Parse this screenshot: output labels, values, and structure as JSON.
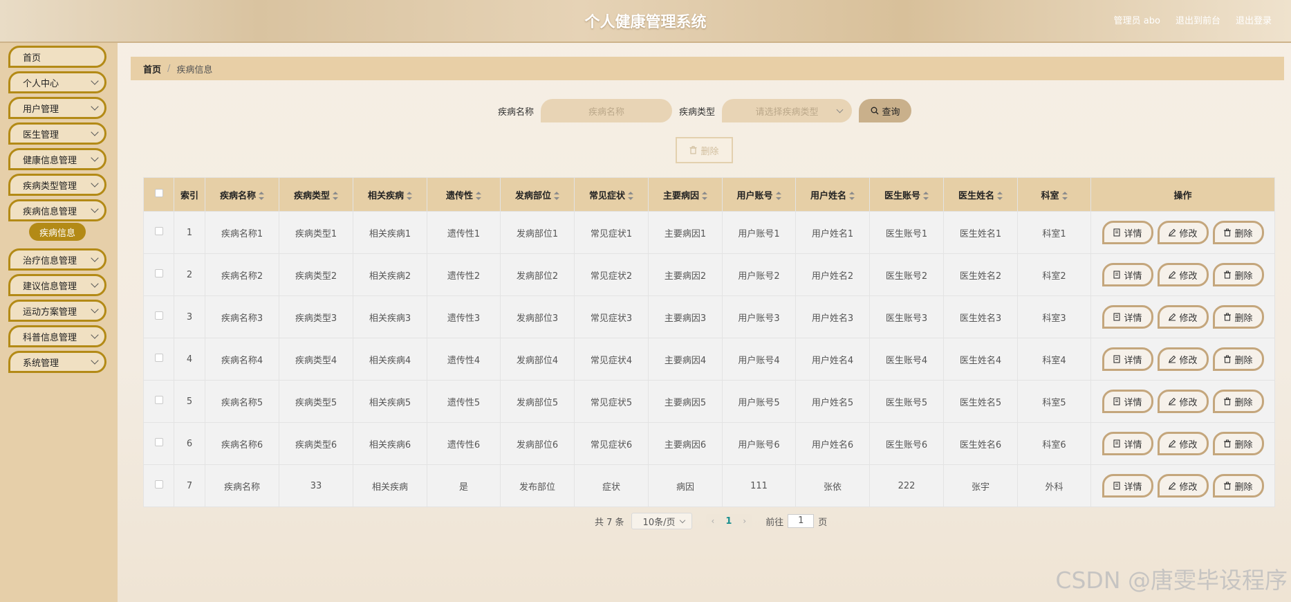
{
  "header": {
    "title": "个人健康管理系统",
    "admin": "管理员 abo",
    "to_front": "退出到前台",
    "logout": "退出登录"
  },
  "sidebar": {
    "items": [
      {
        "label": "首页",
        "has_chevron": false
      },
      {
        "label": "个人中心",
        "has_chevron": true
      },
      {
        "label": "用户管理",
        "has_chevron": true
      },
      {
        "label": "医生管理",
        "has_chevron": true
      },
      {
        "label": "健康信息管理",
        "has_chevron": true
      },
      {
        "label": "疾病类型管理",
        "has_chevron": true
      },
      {
        "label": "疾病信息管理",
        "has_chevron": true
      },
      {
        "label": "治疗信息管理",
        "has_chevron": true
      },
      {
        "label": "建议信息管理",
        "has_chevron": true
      },
      {
        "label": "运动方案管理",
        "has_chevron": true
      },
      {
        "label": "科普信息管理",
        "has_chevron": true
      },
      {
        "label": "系统管理",
        "has_chevron": true
      }
    ],
    "active_sub": "疾病信息"
  },
  "breadcrumb": {
    "home": "首页",
    "sep": "/",
    "current": "疾病信息"
  },
  "search": {
    "name_label": "疾病名称",
    "name_placeholder": "疾病名称",
    "type_label": "疾病类型",
    "type_placeholder": "请选择疾病类型",
    "button": "查询"
  },
  "batch_delete": "删除",
  "table": {
    "columns": [
      "索引",
      "疾病名称",
      "疾病类型",
      "相关疾病",
      "遗传性",
      "发病部位",
      "常见症状",
      "主要病因",
      "用户账号",
      "用户姓名",
      "医生账号",
      "医生姓名",
      "科室",
      "操作"
    ],
    "rows": [
      [
        "1",
        "疾病名称1",
        "疾病类型1",
        "相关疾病1",
        "遗传性1",
        "发病部位1",
        "常见症状1",
        "主要病因1",
        "用户账号1",
        "用户姓名1",
        "医生账号1",
        "医生姓名1",
        "科室1"
      ],
      [
        "2",
        "疾病名称2",
        "疾病类型2",
        "相关疾病2",
        "遗传性2",
        "发病部位2",
        "常见症状2",
        "主要病因2",
        "用户账号2",
        "用户姓名2",
        "医生账号2",
        "医生姓名2",
        "科室2"
      ],
      [
        "3",
        "疾病名称3",
        "疾病类型3",
        "相关疾病3",
        "遗传性3",
        "发病部位3",
        "常见症状3",
        "主要病因3",
        "用户账号3",
        "用户姓名3",
        "医生账号3",
        "医生姓名3",
        "科室3"
      ],
      [
        "4",
        "疾病名称4",
        "疾病类型4",
        "相关疾病4",
        "遗传性4",
        "发病部位4",
        "常见症状4",
        "主要病因4",
        "用户账号4",
        "用户姓名4",
        "医生账号4",
        "医生姓名4",
        "科室4"
      ],
      [
        "5",
        "疾病名称5",
        "疾病类型5",
        "相关疾病5",
        "遗传性5",
        "发病部位5",
        "常见症状5",
        "主要病因5",
        "用户账号5",
        "用户姓名5",
        "医生账号5",
        "医生姓名5",
        "科室5"
      ],
      [
        "6",
        "疾病名称6",
        "疾病类型6",
        "相关疾病6",
        "遗传性6",
        "发病部位6",
        "常见症状6",
        "主要病因6",
        "用户账号6",
        "用户姓名6",
        "医生账号6",
        "医生姓名6",
        "科室6"
      ],
      [
        "7",
        "疾病名称",
        "33",
        "相关疾病",
        "是",
        "发布部位",
        "症状",
        "病因",
        "111",
        "张依",
        "222",
        "张宇",
        "外科"
      ]
    ],
    "actions": {
      "detail": "详情",
      "edit": "修改",
      "delete": "删除"
    }
  },
  "pagination": {
    "total": "共 7 条",
    "page_size": "10条/页",
    "current_page": "1",
    "goto_label": "前往",
    "goto_value": "1",
    "page_unit": "页"
  },
  "watermark": "CSDN @唐雯毕设程序",
  "colors": {
    "accent": "#b38a16",
    "header_bg": "#e6cfa6",
    "button_border": "#c4a67c"
  }
}
